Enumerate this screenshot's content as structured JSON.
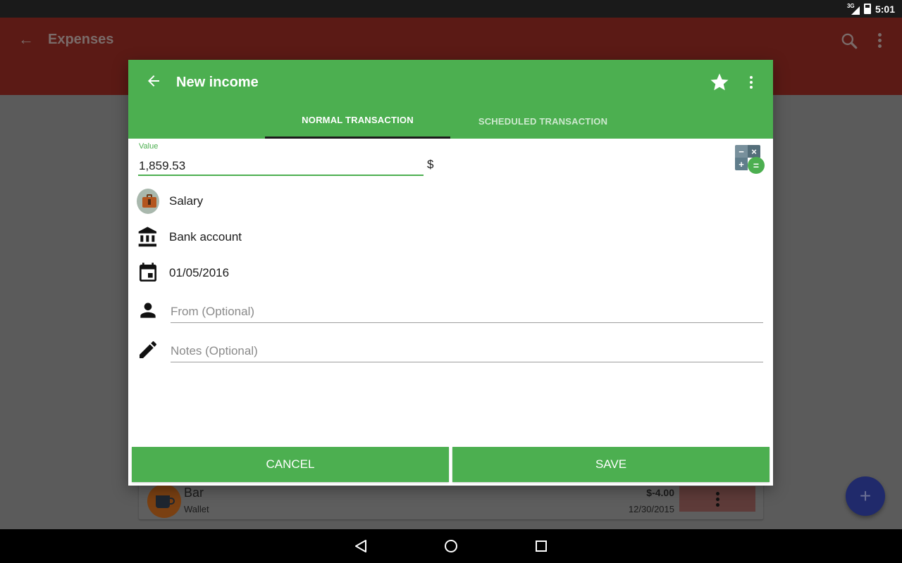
{
  "status_bar": {
    "network": "3G",
    "time": "5:01"
  },
  "background_app": {
    "title": "Expenses",
    "icons": [
      "back-arrow-icon",
      "search-icon",
      "more-vert-icon"
    ],
    "transaction": {
      "name": "Bar",
      "account": "Wallet",
      "amount": "$-4.00",
      "date": "12/30/2015",
      "color": "#f4511e"
    },
    "fab_label": "+",
    "toolbar_color": "#c62828"
  },
  "dialog": {
    "title": "New income",
    "accent_color": "#4caf50",
    "tabs": [
      {
        "label": "NORMAL TRANSACTION",
        "active": true
      },
      {
        "label": "SCHEDULED TRANSACTION",
        "active": false
      }
    ],
    "value_field": {
      "label": "Value",
      "value": "1,859.53",
      "currency": "$"
    },
    "calculator": {
      "keys": [
        "−",
        "×",
        "+",
        "="
      ]
    },
    "category": "Salary",
    "account": "Bank account",
    "date": "01/05/2016",
    "from_field": {
      "placeholder": "From (Optional)",
      "value": ""
    },
    "notes_field": {
      "placeholder": "Notes (Optional)",
      "value": ""
    },
    "buttons": {
      "cancel": "CANCEL",
      "save": "SAVE"
    }
  },
  "nav_bar": {
    "buttons": [
      "back",
      "home",
      "recents"
    ]
  }
}
